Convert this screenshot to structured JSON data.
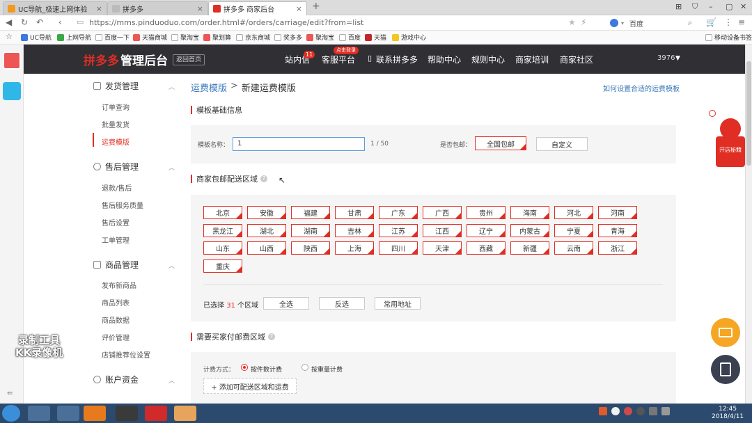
{
  "browser": {
    "tabs": [
      {
        "label": "UC导航_极速上网体验",
        "color": "#f29a1f"
      },
      {
        "label": "拼多多",
        "color": "#bbbbbb"
      },
      {
        "label": "拼多多 商家后台",
        "color": "#e02e24"
      }
    ],
    "new_tab": "+",
    "url": "https://mms.pinduoduo.com/order.html#/orders/carriage/edit?from=list",
    "search_engine": "百度",
    "bookmarks": [
      "UC导航",
      "上网导航",
      "百度一下",
      "天猫商城",
      "聚淘宝",
      "聚划算",
      "京东商城",
      "奖多多",
      "聚淘宝",
      "百度",
      "天猫",
      "游戏中心"
    ],
    "mobile_bookmarks": "移动设备书签"
  },
  "header": {
    "logo": "拼多多",
    "logo_sub": "管理后台",
    "home_button": "返回首页",
    "nav": [
      "站内信",
      "客服平台",
      "联系拼多多",
      "帮助中心",
      "规则中心",
      "商家培训",
      "商家社区"
    ],
    "msg_badge": "11",
    "login_badge": "点击登录",
    "user_id": "3976"
  },
  "sidebar": {
    "groups": [
      {
        "label": "发货管理",
        "items": [
          "订单查询",
          "批量发货",
          "运费模版"
        ]
      },
      {
        "label": "售后管理",
        "items": [
          "退款/售后",
          "售后服务质量",
          "售后设置",
          "工单管理"
        ]
      },
      {
        "label": "商品管理",
        "items": [
          "发布新商品",
          "商品列表",
          "商品数据",
          "评价管理",
          "店铺推荐位设置"
        ]
      },
      {
        "label": "账户资金",
        "items": []
      }
    ],
    "active_item": "运费模版"
  },
  "breadcrumb": {
    "parent": "运费模版",
    "separator": ">",
    "current": "新建运费模版"
  },
  "help_link": "如何设置合适的运费模板",
  "basic_info": {
    "title": "模板基础信息",
    "name_label": "模板名称：",
    "name_value": "1",
    "counter": "1 / 50",
    "free_label": "是否包邮：",
    "free_options": [
      "全国包邮",
      "自定义"
    ]
  },
  "free_region": {
    "title": "商家包邮配送区域",
    "regions": [
      "北京",
      "安徽",
      "福建",
      "甘肃",
      "广东",
      "广西",
      "贵州",
      "海南",
      "河北",
      "河南",
      "黑龙江",
      "湖北",
      "湖南",
      "吉林",
      "江苏",
      "江西",
      "辽宁",
      "内蒙古",
      "宁夏",
      "青海",
      "山东",
      "山西",
      "陕西",
      "上海",
      "四川",
      "天津",
      "西藏",
      "新疆",
      "云南",
      "浙江",
      "重庆"
    ],
    "selected_prefix": "已选择",
    "selected_count": "31",
    "selected_suffix": "个区域",
    "actions": [
      "全选",
      "反选",
      "常用地址"
    ]
  },
  "paid_region": {
    "title": "需要买家付邮费区域",
    "calc_label": "计费方式：",
    "calc_options": [
      "按件数计费",
      "按重量计费"
    ],
    "add_button": "+ 添加可配送区域和运费"
  },
  "floating": {
    "shop_label": "开店秘籍"
  },
  "taskbar": {
    "time": "12:45",
    "date": "2018/4/11"
  },
  "watermark": {
    "line1": "录制工具",
    "line2": "KK录像机"
  },
  "colors": {
    "accent": "#e02e24",
    "header_bg": "#2f2f34",
    "link": "#3b7ab8"
  }
}
